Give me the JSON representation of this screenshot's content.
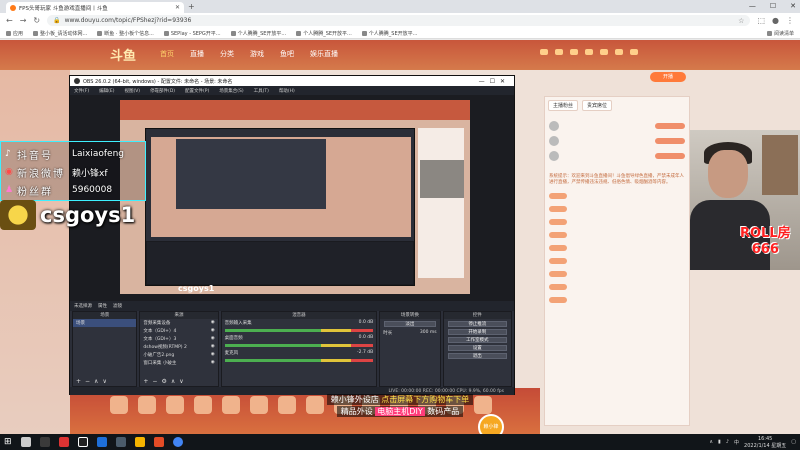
{
  "browser": {
    "tab_title": "FPS头哥玩家 斗鱼游戏直播间丨斗鱼",
    "url": "www.douyu.com/topic/FPShezj?rid=93936",
    "bookmarks": [
      "应用",
      "整小板_请活动体网...",
      "断鱼 · 整小板个信息...",
      "SEPlay - SEPG开平...",
      "个人腾腾_SE开放平...",
      "个人腾腾_SE开放平...",
      "个人腾腾_SE开放平..."
    ],
    "reading_list": "阅读清单"
  },
  "douyu": {
    "logo": "斗鱼",
    "nav": [
      "首页",
      "直播",
      "分类",
      "游戏",
      "鱼吧",
      "娱乐直播"
    ],
    "open_stream": "开播",
    "chat_tabs": [
      "主播粉丝",
      "贵宾席位"
    ],
    "notice": "系统提示：欢迎来到斗鱼直播间！斗鱼倡导绿色直播，严禁未成年人进行直播，严禁传播违法违规、低俗色情、吸烟酗酒等内容。"
  },
  "obs": {
    "title": "OBS 26.0.2 (64-bit, windows) - 配置文件: 未命名 - 场景: 未命名",
    "menu": [
      "文件(F)",
      "编辑(E)",
      "视图(V)",
      "停靠部件(D)",
      "配置文件(P)",
      "场景集合(S)",
      "工具(T)",
      "帮助(H)"
    ],
    "scene_bar": [
      "未选择源",
      "属性",
      "滤镜"
    ],
    "docks": {
      "scenes_title": "场景",
      "scene": "场景",
      "sources_title": "来源",
      "sources": [
        "音频采集设备",
        "文本（GDI+）4",
        "文本（GDI+）3",
        "dshow视频(RTMP) 2",
        "小破广告2.png",
        "窗口采集 小破主"
      ],
      "mixer_title": "混音器",
      "mixer": [
        {
          "name": "音频输入采集",
          "level": "0.0 dB"
        },
        {
          "name": "桌面音频",
          "level": "0.0 dB"
        },
        {
          "name": "麦克风",
          "level": "-2.7 dB"
        }
      ],
      "transitions_title": "场景转换",
      "transition": "淡出",
      "duration_label": "时长",
      "duration": "300 ms",
      "controls_title": "控件",
      "controls": [
        "停止推流",
        "开始录制",
        "工作室模式",
        "设置",
        "退出"
      ]
    },
    "status": "LIVE: 00:00:00   REC: 00:00:00   CPU: 9.9%, 60.00 fps"
  },
  "overlay": {
    "info": [
      {
        "label": "抖音号",
        "value": "Laixiaofeng",
        "icon": "tiktok-icon"
      },
      {
        "label": "新浪微博",
        "value": "赖小锋xf",
        "icon": "weibo-icon"
      },
      {
        "label": "粉丝群",
        "value": "5960008",
        "icon": "fans-icon"
      }
    ],
    "streamer_name": "csgoys1",
    "nested_name": "csgoys1",
    "roll_title": "ROLL房",
    "roll_number": "666",
    "ad_line1_a": "赖小锋外设店",
    "ad_line1_b": "点击屏幕下方购物车下单",
    "ad_line2_a": "精品外设",
    "ad_line2_b": "电脑主机DIY",
    "ad_line2_tag": "数码产品",
    "ad_logo": "赖小锋"
  },
  "taskbar": {
    "time": "16:45",
    "date": "2022/1/14 星期五",
    "lang": "中"
  }
}
